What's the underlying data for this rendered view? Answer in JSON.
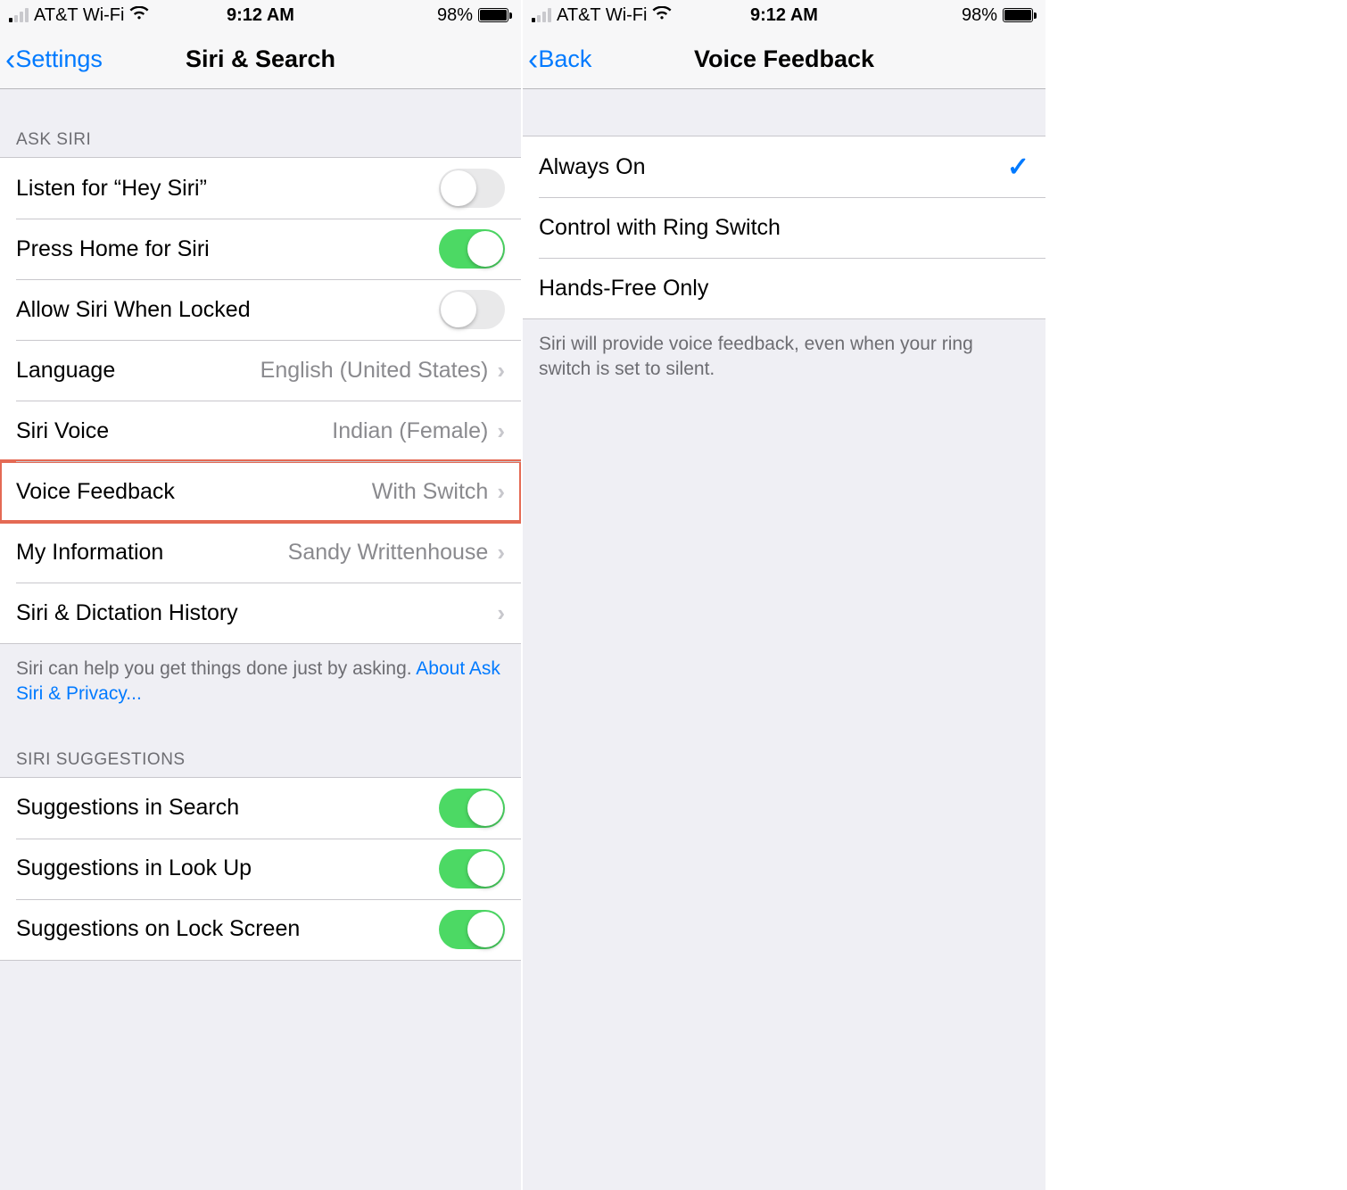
{
  "status": {
    "carrier": "AT&T Wi-Fi",
    "time": "9:12 AM",
    "battery_pct": "98%"
  },
  "left": {
    "nav_back": "Settings",
    "nav_title": "Siri & Search",
    "section_ask_siri": "Ask Siri",
    "rows": {
      "listen": "Listen for “Hey Siri”",
      "press_home": "Press Home for Siri",
      "allow_locked": "Allow Siri When Locked",
      "language": "Language",
      "language_value": "English (United States)",
      "siri_voice": "Siri Voice",
      "siri_voice_value": "Indian (Female)",
      "voice_feedback": "Voice Feedback",
      "voice_feedback_value": "With Switch",
      "my_info": "My Information",
      "my_info_value": "Sandy Writtenhouse",
      "history": "Siri & Dictation History"
    },
    "footer_main": "Siri can help you get things done just by asking. ",
    "footer_link": "About Ask Siri & Privacy...",
    "section_suggestions": "Siri Suggestions",
    "sugg": {
      "search": "Suggestions in Search",
      "lookup": "Suggestions in Look Up",
      "lockscreen": "Suggestions on Lock Screen"
    }
  },
  "right": {
    "nav_back": "Back",
    "nav_title": "Voice Feedback",
    "options": {
      "always": "Always On",
      "ring": "Control with Ring Switch",
      "hands": "Hands-Free Only"
    },
    "footer": "Siri will provide voice feedback, even when your ring switch is set to silent."
  }
}
